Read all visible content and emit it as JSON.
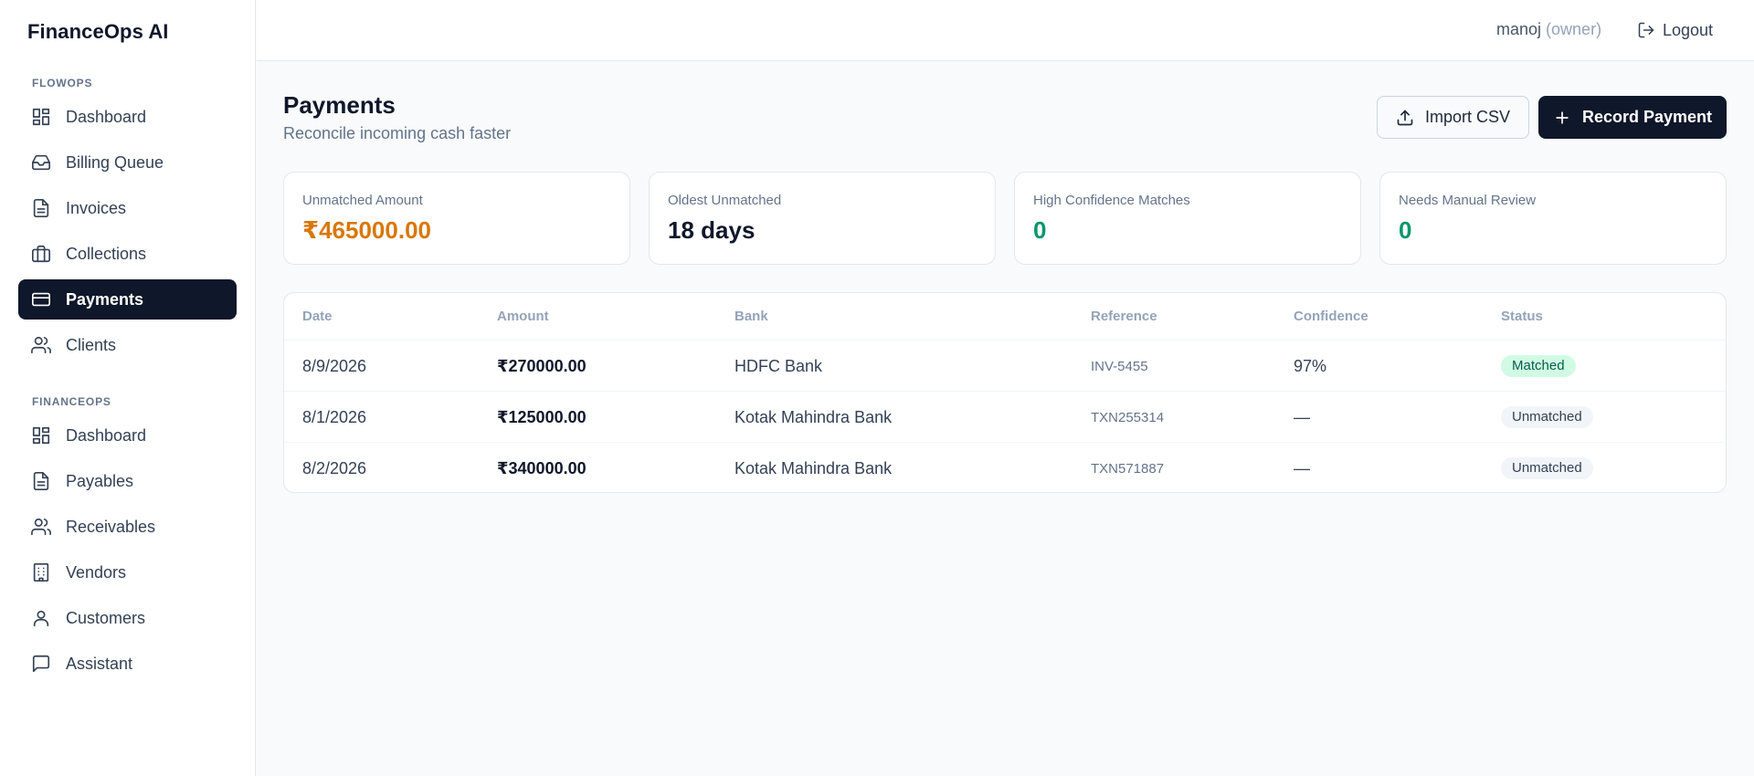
{
  "app": {
    "brand": "FinanceOps AI"
  },
  "sidebar": {
    "sections": [
      {
        "label": "FLOWOPS"
      },
      {
        "label": "FINANCEOPS"
      }
    ],
    "items": [
      {
        "label": "Dashboard",
        "icon": "dashboard-icon"
      },
      {
        "label": "Billing Queue",
        "icon": "inbox-icon"
      },
      {
        "label": "Invoices",
        "icon": "file-icon"
      },
      {
        "label": "Collections",
        "icon": "briefcase-icon"
      },
      {
        "label": "Payments",
        "icon": "credit-card-icon",
        "active": true
      },
      {
        "label": "Clients",
        "icon": "users-icon"
      },
      {
        "label": "Dashboard",
        "icon": "dashboard-icon"
      },
      {
        "label": "Payables",
        "icon": "file-icon"
      },
      {
        "label": "Receivables",
        "icon": "users-icon"
      },
      {
        "label": "Vendors",
        "icon": "building-icon"
      },
      {
        "label": "Customers",
        "icon": "user-icon"
      },
      {
        "label": "Assistant",
        "icon": "message-icon"
      }
    ]
  },
  "header": {
    "user_name": "manoj",
    "user_role": "(owner)",
    "logout_label": "Logout"
  },
  "page": {
    "title": "Payments",
    "subtitle": "Reconcile incoming cash faster",
    "import_label": "Import CSV",
    "record_label": "Record Payment"
  },
  "stats": [
    {
      "label": "Unmatched Amount",
      "value": "₹465000.00",
      "color": "#d97706"
    },
    {
      "label": "Oldest Unmatched",
      "value": "18 days",
      "color": "#0f172a"
    },
    {
      "label": "High Confidence Matches",
      "value": "0",
      "color": "#059669"
    },
    {
      "label": "Needs Manual Review",
      "value": "0",
      "color": "#059669"
    }
  ],
  "table": {
    "columns": [
      "Date",
      "Amount",
      "Bank",
      "Reference",
      "Confidence",
      "Status"
    ],
    "rows": [
      {
        "date": "8/9/2026",
        "amount": "₹270000.00",
        "bank": "HDFC Bank",
        "reference": "INV-5455",
        "confidence": "97%",
        "status": "Matched"
      },
      {
        "date": "8/1/2026",
        "amount": "₹125000.00",
        "bank": "Kotak Mahindra Bank",
        "reference": "TXN255314",
        "confidence": "—",
        "status": "Unmatched"
      },
      {
        "date": "8/2/2026",
        "amount": "₹340000.00",
        "bank": "Kotak Mahindra Bank",
        "reference": "TXN571887",
        "confidence": "—",
        "status": "Unmatched"
      }
    ]
  },
  "colors": {
    "primary": "#0f172a",
    "warning": "#d97706",
    "success": "#059669",
    "matched_badge_bg": "#d1fae5",
    "unmatched_badge_bg": "#f1f5f9"
  }
}
